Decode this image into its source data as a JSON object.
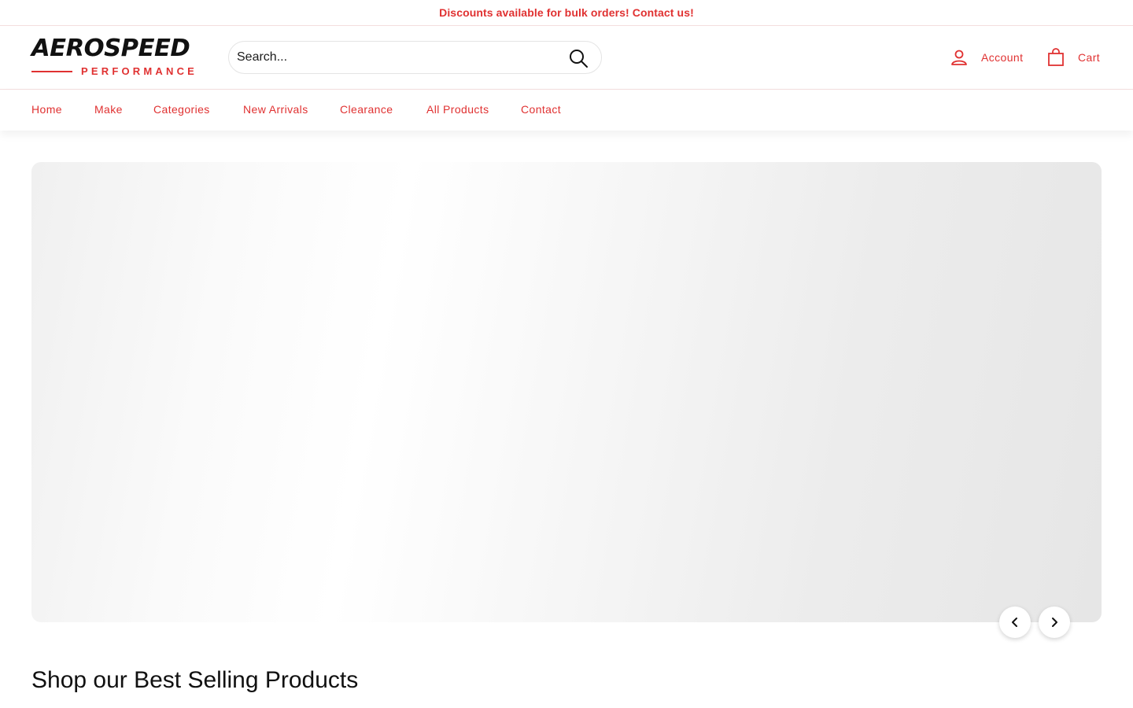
{
  "announcement": {
    "text": "Discounts available for bulk orders! Contact us!"
  },
  "brand": {
    "name": "AEROSPEED",
    "tagline": "PERFORMANCE",
    "accent_color": "#e03131"
  },
  "search": {
    "placeholder": "Search...",
    "icon": "search-icon"
  },
  "header_links": {
    "account": {
      "label": "Account",
      "icon": "user-icon"
    },
    "cart": {
      "label": "Cart",
      "icon": "bag-icon"
    }
  },
  "nav": {
    "items": [
      {
        "label": "Home"
      },
      {
        "label": "Make"
      },
      {
        "label": "Categories"
      },
      {
        "label": "New Arrivals"
      },
      {
        "label": "Clearance"
      },
      {
        "label": "All Products"
      },
      {
        "label": "Contact"
      }
    ]
  },
  "hero": {
    "prev_icon": "chevron-left-icon",
    "next_icon": "chevron-right-icon"
  },
  "sections": {
    "best_sellers_title": "Shop our Best Selling Products"
  }
}
